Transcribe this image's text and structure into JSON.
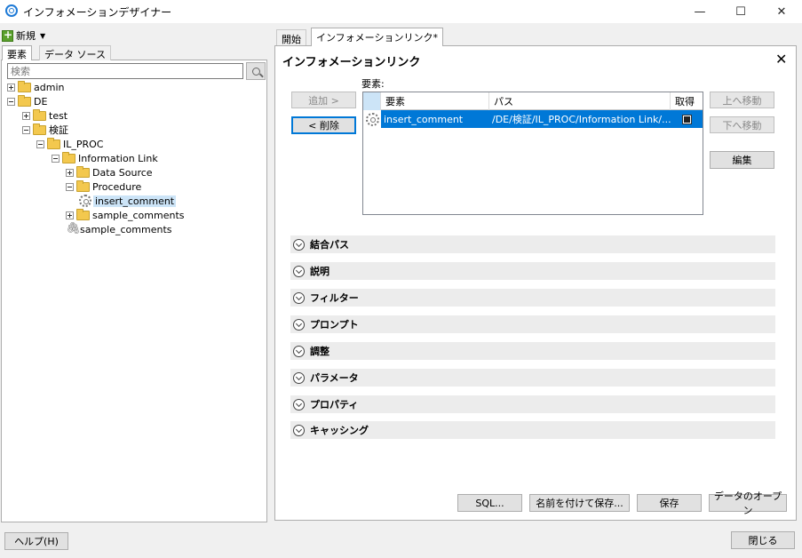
{
  "window": {
    "title": "インフォメーションデザイナー",
    "minimize": "—",
    "maximize": "☐",
    "close": "✕"
  },
  "left": {
    "new_label": "新規",
    "tabs": [
      "要素",
      "データ ソース"
    ],
    "search_placeholder": "検索",
    "tree": [
      {
        "label": "admin"
      },
      {
        "label": "DE"
      },
      {
        "label": "test"
      },
      {
        "label": "検証"
      },
      {
        "label": "IL_PROC"
      },
      {
        "label": "Information Link"
      },
      {
        "label": "Data Source"
      },
      {
        "label": "Procedure"
      },
      {
        "label": "insert_comment"
      },
      {
        "label": "sample_comments"
      },
      {
        "label": "sample_comments"
      }
    ],
    "help_label": "ヘルプ(H)"
  },
  "right": {
    "tabs": [
      "開始",
      "インフォメーションリンク*"
    ],
    "panel_title": "インフォメーションリンク",
    "close_label": "✕",
    "elements_label": "要素:",
    "add_label": "追加 >",
    "delete_label": "< 削除",
    "move_up_label": "上へ移動",
    "move_down_label": "下へ移動",
    "edit_label": "編集",
    "grid": {
      "columns": [
        "要素",
        "パス",
        "取得"
      ],
      "rows": [
        {
          "element": "insert_comment",
          "path": "/DE/検証/IL_PROC/Information Link/...",
          "fetch": true
        }
      ]
    },
    "sections": [
      "結合パス",
      "説明",
      "フィルター",
      "プロンプト",
      "調整",
      "パラメータ",
      "プロパティ",
      "キャッシング"
    ],
    "sql_label": "SQL...",
    "save_as_label": "名前を付けて保存...",
    "save_label": "保存",
    "open_data_label": "データのオープン",
    "close_button_label": "閉じる"
  }
}
